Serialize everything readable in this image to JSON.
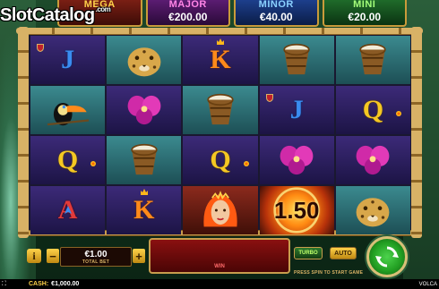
{
  "watermark": {
    "text": "SlotCatalog",
    "suffix": ".com"
  },
  "jackpots": [
    {
      "label": "MEGA",
      "value": ""
    },
    {
      "label": "MAJOR",
      "value": "€200.00"
    },
    {
      "label": "MINOR",
      "value": "€40.00"
    },
    {
      "label": "MINI",
      "value": "€20.00"
    }
  ],
  "reels": {
    "rows": [
      [
        {
          "symbol": "J",
          "kind": "letter",
          "bg": "purple",
          "icon": "shield-emblem-icon"
        },
        {
          "symbol": "jaguar",
          "kind": "picture",
          "bg": "teal",
          "icon": "jaguar-icon"
        },
        {
          "symbol": "K",
          "kind": "letter",
          "bg": "purple",
          "icon": "crown-emblem-icon"
        },
        {
          "symbol": "drum",
          "kind": "picture",
          "bg": "teal",
          "icon": "drum-icon"
        },
        {
          "symbol": "drum",
          "kind": "picture",
          "bg": "teal",
          "icon": "drum-icon"
        }
      ],
      [
        {
          "symbol": "toucan",
          "kind": "picture",
          "bg": "teal",
          "icon": "toucan-icon"
        },
        {
          "symbol": "orchid",
          "kind": "picture",
          "bg": "purple",
          "icon": "orchid-icon"
        },
        {
          "symbol": "drum",
          "kind": "picture",
          "bg": "teal",
          "icon": "drum-icon"
        },
        {
          "symbol": "J",
          "kind": "letter",
          "bg": "purple",
          "icon": "shield-emblem-icon"
        },
        {
          "symbol": "Q",
          "kind": "letter",
          "bg": "purple",
          "icon": "sun-emblem-icon"
        }
      ],
      [
        {
          "symbol": "Q",
          "kind": "letter",
          "bg": "purple",
          "icon": "sun-emblem-icon"
        },
        {
          "symbol": "drum",
          "kind": "picture",
          "bg": "teal",
          "icon": "drum-icon"
        },
        {
          "symbol": "Q",
          "kind": "letter",
          "bg": "purple",
          "icon": "sun-emblem-icon"
        },
        {
          "symbol": "orchid",
          "kind": "picture",
          "bg": "purple",
          "icon": "orchid-icon"
        },
        {
          "symbol": "orchid",
          "kind": "picture",
          "bg": "purple",
          "icon": "orchid-icon"
        }
      ],
      [
        {
          "symbol": "A",
          "kind": "letter",
          "bg": "purple",
          "icon": "arrowhead-emblem-icon"
        },
        {
          "symbol": "K",
          "kind": "letter",
          "bg": "purple",
          "icon": "crown-emblem-icon"
        },
        {
          "symbol": "queen",
          "kind": "picture",
          "bg": "red",
          "icon": "fire-queen-icon"
        },
        {
          "symbol": "1.50",
          "kind": "multiplier",
          "bg": "fire",
          "icon": "fireball-icon"
        },
        {
          "symbol": "jaguar",
          "kind": "picture",
          "bg": "teal",
          "icon": "jaguar-icon"
        }
      ]
    ]
  },
  "controls": {
    "info_label": "i",
    "minus_label": "−",
    "plus_label": "+",
    "bet_value": "€1.00",
    "bet_label": "TOTAL BET",
    "win_label": "WIN",
    "turbo_label": "TURBO",
    "auto_label": "AUTO",
    "press_spin": "PRESS SPIN TO START GAME"
  },
  "footer": {
    "cash_label": "CASH:",
    "cash_value": "€1,000.00",
    "brand": "VOLCA"
  },
  "colors": {
    "frame": "#c89d4d",
    "jp_mega": "#ffd24a",
    "jp_major": "#ff84e6",
    "jp_minor": "#8ad0ff",
    "jp_mini": "#a4ff7a",
    "spin": "#23a023"
  }
}
